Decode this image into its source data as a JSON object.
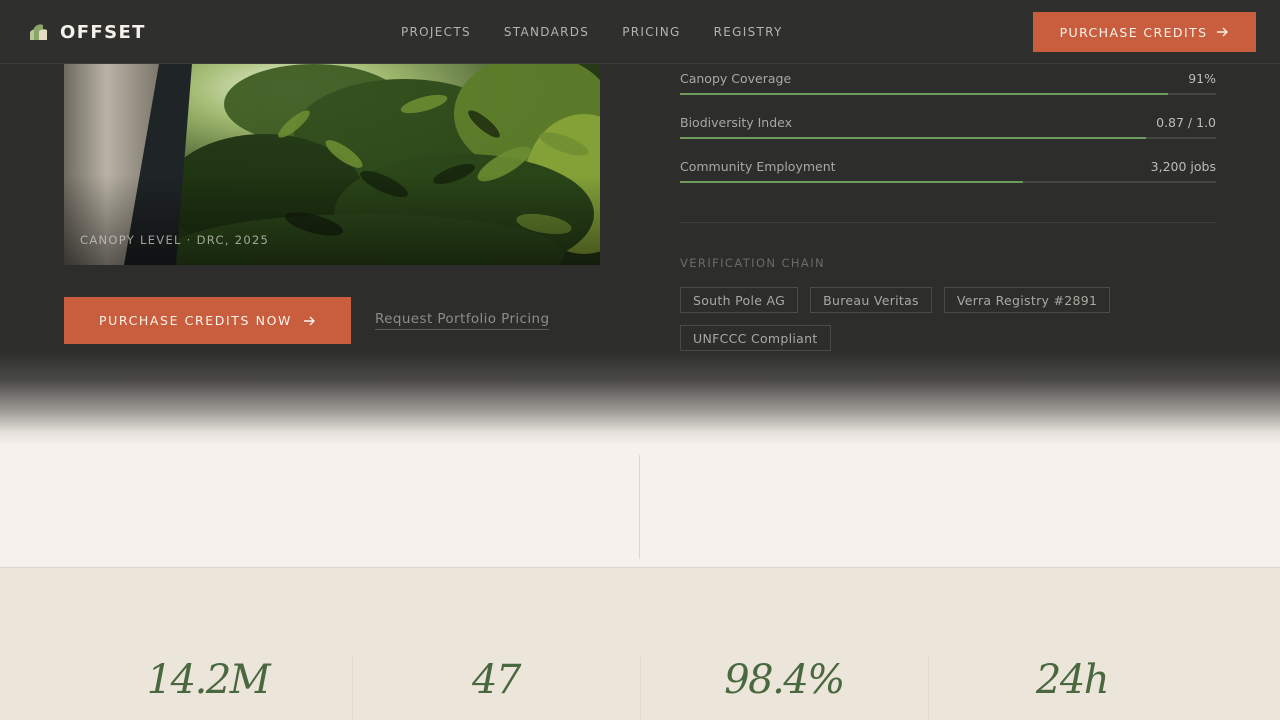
{
  "header": {
    "brand": "OFFSET",
    "nav": [
      "PROJECTS",
      "STANDARDS",
      "PRICING",
      "REGISTRY"
    ],
    "cta_label": "PURCHASE CREDITS"
  },
  "hero": {
    "photo_caption": "CANOPY LEVEL · DRC, 2025",
    "primary_cta": "PURCHASE CREDITS NOW",
    "secondary_cta": "Request Portfolio Pricing"
  },
  "metrics": [
    {
      "label": "Canopy Coverage",
      "value": "91%",
      "fill_fraction": 0.91
    },
    {
      "label": "Biodiversity Index",
      "value": "0.87 / 1.0",
      "fill_fraction": 0.87
    },
    {
      "label": "Community Employment",
      "value": "3,200 jobs",
      "fill_fraction": 0.64
    }
  ],
  "verification": {
    "title": "VERIFICATION CHAIN",
    "chips": [
      "South Pole AG",
      "Bureau Veritas",
      "Verra Registry #2891",
      "UNFCCC Compliant"
    ]
  },
  "stats": [
    "14.2M",
    "47",
    "98.4%",
    "24h"
  ],
  "colors": {
    "accent": "#c85e3e",
    "dark_bg": "#2d2e2b",
    "progress": "#6e9a5d",
    "stat_text": "#4a6840",
    "light_bg": "#f6f1ec",
    "sand_bg": "#ece6da"
  },
  "icons": {
    "logo": "leaf-logo-icon",
    "arrow": "arrow-right-icon"
  }
}
